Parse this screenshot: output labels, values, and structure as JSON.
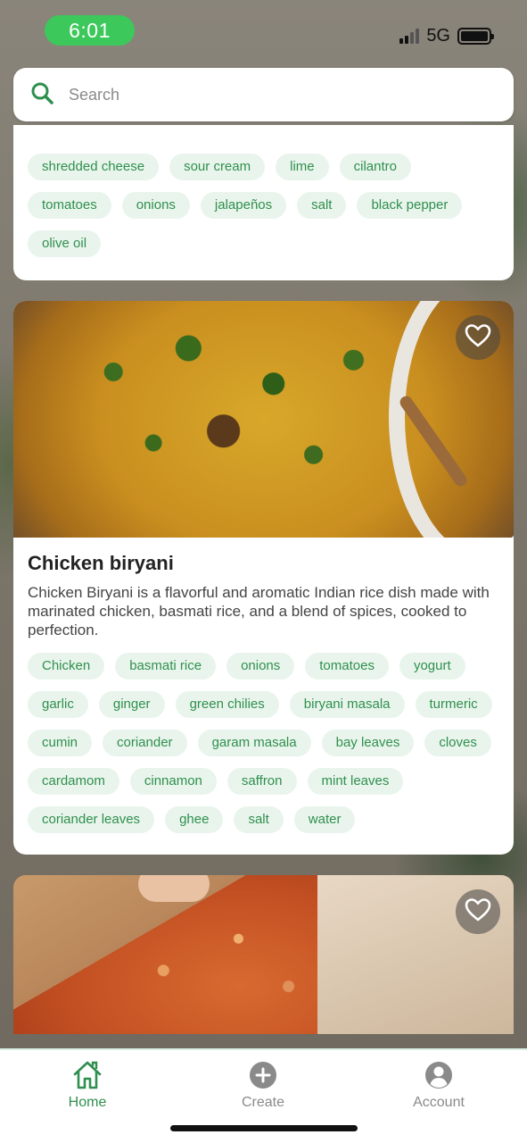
{
  "status_bar": {
    "time": "6:01",
    "network": "5G"
  },
  "search": {
    "placeholder": "Search"
  },
  "cards": [
    {
      "ingredients": [
        "shredded cheese",
        "sour cream",
        "lime",
        "cilantro",
        "tomatoes",
        "onions",
        "jalapeños",
        "salt",
        "black pepper",
        "olive oil"
      ]
    },
    {
      "title": "Chicken biryani",
      "description": "Chicken Biryani is a flavorful and aromatic Indian rice dish made with marinated chicken, basmati rice, and a blend of spices, cooked to perfection.",
      "ingredients": [
        "Chicken",
        "basmati rice",
        "onions",
        "tomatoes",
        "yogurt",
        "garlic",
        "ginger",
        "green chilies",
        "biryani masala",
        "turmeric",
        "cumin",
        "coriander",
        "garam masala",
        "bay leaves",
        "cloves",
        "cardamom",
        "cinnamon",
        "saffron",
        "mint leaves",
        "coriander leaves",
        "ghee",
        "salt",
        "water"
      ]
    },
    {}
  ],
  "tabbar": {
    "home": "Home",
    "create": "Create",
    "account": "Account"
  },
  "colors": {
    "accent": "#2f8f4e",
    "tag_bg": "#e9f5ec",
    "status_pill": "#3cc85a",
    "inactive": "#8a8a8a"
  },
  "icons": {
    "search": "search-icon",
    "favorite": "heart-icon",
    "home": "home-icon",
    "create": "plus-circle-icon",
    "account": "user-circle-icon"
  }
}
